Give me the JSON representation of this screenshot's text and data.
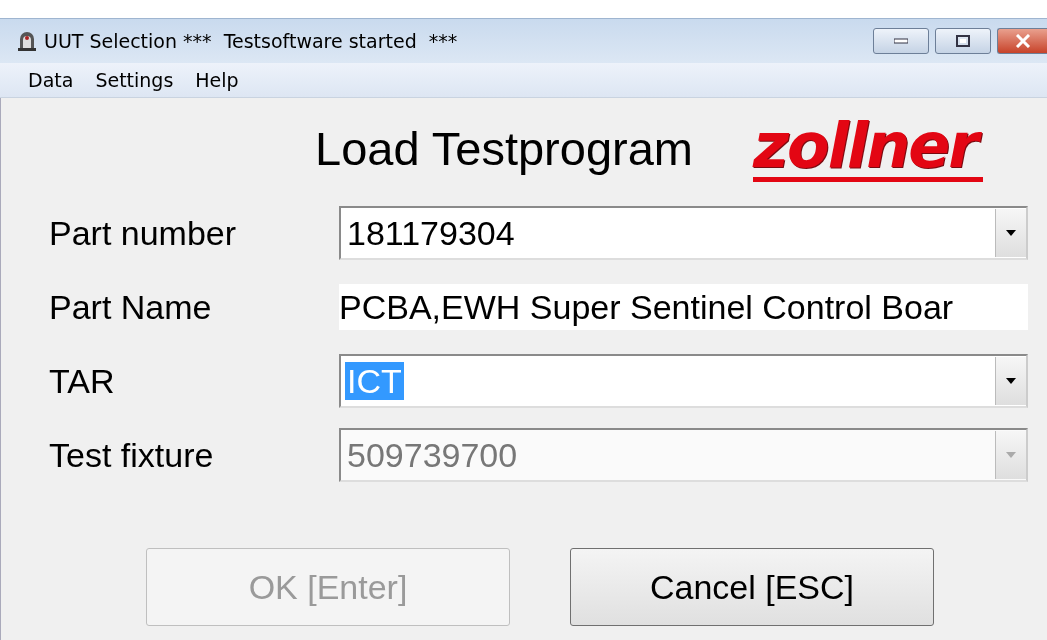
{
  "window": {
    "title": "UUT Selection ***  Testsoftware started  ***"
  },
  "menu": [
    {
      "label": "Data"
    },
    {
      "label": "Settings"
    },
    {
      "label": "Help"
    }
  ],
  "heading": "Load Testprogram",
  "logo": "zollner",
  "fields": [
    {
      "label": "Part number",
      "kind": "combo",
      "value": "181179304",
      "disabled": false,
      "highlighted": false
    },
    {
      "label": "Part Name",
      "kind": "text",
      "value": "PCBA,EWH Super Sentinel Control Boar"
    },
    {
      "label": "TAR",
      "kind": "combo",
      "value": "ICT",
      "disabled": false,
      "highlighted": true
    },
    {
      "label": "Test fixture",
      "kind": "combo",
      "value": "509739700",
      "disabled": true,
      "highlighted": false
    }
  ],
  "buttons": [
    {
      "label": "OK [Enter]",
      "disabled": true
    },
    {
      "label": "Cancel [ESC]",
      "disabled": false
    }
  ]
}
